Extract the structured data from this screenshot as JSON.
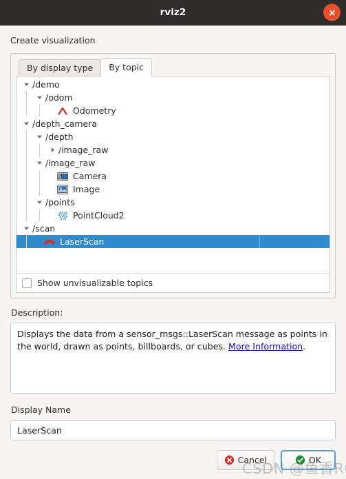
{
  "window": {
    "title": "rviz2",
    "close_icon": "close-icon"
  },
  "header": {
    "section_label": "Create visualization"
  },
  "tabs": [
    {
      "label": "By display type",
      "active": false
    },
    {
      "label": "By topic",
      "active": true
    }
  ],
  "tree": {
    "rows": [
      {
        "label": "/demo",
        "depth": 0,
        "arrow": "expanded",
        "icon": ""
      },
      {
        "label": "/odom",
        "depth": 1,
        "arrow": "expanded",
        "icon": ""
      },
      {
        "label": "Odometry",
        "depth": 2,
        "arrow": "none",
        "icon": "odometry-icon"
      },
      {
        "label": "/depth_camera",
        "depth": 0,
        "arrow": "expanded",
        "icon": ""
      },
      {
        "label": "/depth",
        "depth": 1,
        "arrow": "expanded",
        "icon": ""
      },
      {
        "label": "/image_raw",
        "depth": 2,
        "arrow": "collapsed",
        "icon": ""
      },
      {
        "label": "/image_raw",
        "depth": 1,
        "arrow": "expanded",
        "icon": ""
      },
      {
        "label": "Camera",
        "depth": 2,
        "arrow": "none",
        "icon": "camera-icon"
      },
      {
        "label": "Image",
        "depth": 2,
        "arrow": "none",
        "icon": "image-icon"
      },
      {
        "label": "/points",
        "depth": 1,
        "arrow": "expanded",
        "icon": ""
      },
      {
        "label": "PointCloud2",
        "depth": 2,
        "arrow": "none",
        "icon": "pointcloud-icon"
      },
      {
        "label": "/scan",
        "depth": 0,
        "arrow": "expanded",
        "icon": ""
      },
      {
        "label": "LaserScan",
        "depth": 1,
        "arrow": "none",
        "icon": "laserscan-icon",
        "selected": true
      }
    ],
    "selection_color": "#2e8bce"
  },
  "unvisualizable": {
    "label": "Show unvisualizable topics",
    "checked": false
  },
  "description": {
    "label": "Description:",
    "text_before": "Displays the data from a sensor_msgs::LaserScan message as points in the world, drawn as points, billboards, or cubes. ",
    "link_text": "More Information",
    "text_after": "."
  },
  "display_name": {
    "label": "Display Name",
    "value": "LaserScan",
    "placeholder": ""
  },
  "footer": {
    "cancel_label": "Cancel",
    "ok_label": "OK",
    "cancel_icon": "cancel-circle-icon",
    "ok_icon": "ok-circle-icon"
  },
  "watermark": {
    "text": "CSDN @鱼香ROS"
  },
  "colors": {
    "titlebar_bg": "#302c2b",
    "close_btn": "#e8502b",
    "accent_selection": "#2e8bce",
    "link": "#1a0dab",
    "dialog_bg": "#f6f5f4"
  }
}
